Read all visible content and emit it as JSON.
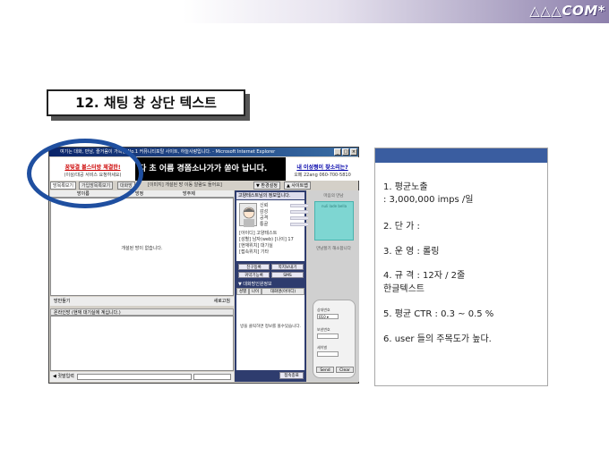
{
  "header": {
    "logo": "△△△COM*"
  },
  "slide": {
    "title": "12. 채팅 창  상단 텍스트"
  },
  "window": {
    "title": "여기는 대화, 만남, 즐거움이 가득한 No.1 커뮤니티포탈 사이트, 하늘사랑입니다. - Microsoft Internet Explorer",
    "controls": [
      "_",
      "□",
      "×"
    ]
  },
  "ads": {
    "left_line1": "꿈빛결 볼스터방 체결한!",
    "left_line2": "(이상/대공 서비스 요청하세요)",
    "middle": "다 초 어름 경쯤소나가가 쏟아 납니다.",
    "right_line1": "내 이성쩡이 찾소리는?",
    "right_line2": "오메 22ang 060-700-5810"
  },
  "tabs": [
    "방목록보기",
    "가입방목록보기",
    "대화방"
  ],
  "notice": "[이미지] 개설된 방 이동 알람도 들어요]",
  "top_buttons": [
    "▼ 환경설정",
    "▲ 사이트맵"
  ],
  "room_list": {
    "columns": [
      "방이름",
      "방정",
      "방주제"
    ],
    "empty": "개설된 방이 없습니다."
  },
  "room_bottom": {
    "left": "방만들기",
    "right": "새로고침"
  },
  "chat": {
    "header": "온라인방 (현재 대기실에 계십니다.)",
    "input_label": "◀ 귓말입력"
  },
  "profile": {
    "title": "고양테스트님의 정보입니다.",
    "stats": [
      {
        "label": "신뢰",
        "value": "0"
      },
      {
        "label": "감성",
        "value": "0"
      },
      {
        "label": "공격",
        "value": "0"
      },
      {
        "label": "통골",
        "value": "0"
      }
    ],
    "info_lines": [
      "[아이디] 고양테스트",
      "[성별] 남자(web) [나이] 17",
      "[현재위치] 대기실",
      "[접속위치] 기타"
    ],
    "buttons": [
      "친구등록",
      "쪽지보내기",
      "귀약기능록",
      "SMS"
    ],
    "lower_title": "▼ 대화방인원정보",
    "lower_columns": [
      "성별",
      "나이",
      "대화명(아이디)"
    ],
    "lower_text": "방을 클릭하면 정보를 볼수있습니다.",
    "close_button": "접속종료"
  },
  "side_panel": {
    "label": "마음의 만남",
    "image_text": "nuli lade bella",
    "caption": "만남할기 해소합니다",
    "fields": [
      "상대번호",
      "보낸번호",
      "세이벌"
    ],
    "field_value": "010 ▾",
    "send": "Send",
    "clear": "Clear"
  },
  "info": {
    "lines": [
      "1. 평균노출",
      "    : 3,000,000 imps /일",
      "2. 단      가 :",
      "3. 운      영 : 롤링",
      "4. 규      격 : 12자 / 2줄",
      "                  한글텍스트",
      "5. 평균 CTR : 0.3 ~ 0.5 %",
      "6. user 들의 주목도가 높다."
    ]
  },
  "colors": {
    "accent_blue": "#1f4fa0",
    "info_header": "#3a5da0",
    "panel_navy": "#2e3c6e",
    "ad_mint": "#7ed6d2"
  }
}
